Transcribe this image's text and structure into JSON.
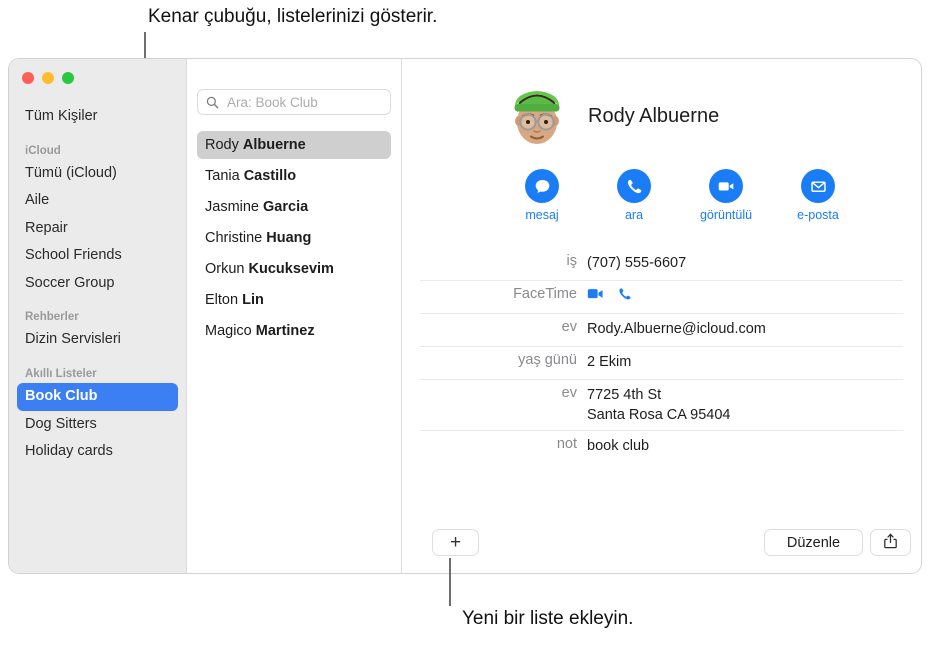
{
  "callouts": {
    "top": "Kenar çubuğu, listelerinizi gösterir.",
    "bottom": "Yeni bir liste ekleyin."
  },
  "colors": {
    "accent": "#1a7df5",
    "selection": "#3b7ff2",
    "list_selection": "#cfcfcf",
    "sidebar_bg": "#ebebeb",
    "traffic_red": "#ff5f57",
    "traffic_yellow": "#febc2e",
    "traffic_green": "#28c840"
  },
  "window": {
    "traffic_lights": [
      "close-button",
      "minimize-button",
      "zoom-button"
    ]
  },
  "sidebar": {
    "top_item": "Tüm Kişiler",
    "sections": [
      {
        "header": "iCloud",
        "items": [
          "Tümü (iCloud)",
          "Aile",
          "Repair",
          "School Friends",
          "Soccer Group"
        ]
      },
      {
        "header": "Rehberler",
        "items": [
          "Dizin Servisleri"
        ]
      },
      {
        "header": "Akıllı Listeler",
        "items": [
          "Book Club",
          "Dog Sitters",
          "Holiday cards"
        ]
      }
    ],
    "selected": "Book Club"
  },
  "search": {
    "placeholder": "Ara: Book Club",
    "value": "",
    "icon": "search-icon"
  },
  "contacts": {
    "items": [
      {
        "first": "Rody ",
        "last": "Albuerne",
        "selected": true
      },
      {
        "first": "Tania ",
        "last": "Castillo",
        "selected": false
      },
      {
        "first": "Jasmine ",
        "last": "Garcia",
        "selected": false
      },
      {
        "first": "Christine ",
        "last": "Huang",
        "selected": false
      },
      {
        "first": "Orkun ",
        "last": "Kucuksevim",
        "selected": false
      },
      {
        "first": "Elton ",
        "last": "Lin",
        "selected": false
      },
      {
        "first": "Magico ",
        "last": "Martinez",
        "selected": false
      }
    ]
  },
  "detail": {
    "name": "Rody Albuerne",
    "avatar": "memoji-avatar",
    "actions": [
      {
        "label": "mesaj",
        "icon": "message-icon"
      },
      {
        "label": "ara",
        "icon": "phone-icon"
      },
      {
        "label": "görüntülü",
        "icon": "video-icon"
      },
      {
        "label": "e-posta",
        "icon": "mail-icon"
      }
    ],
    "fields": [
      {
        "label": "iş",
        "value": "(707) 555-6607",
        "type": "text"
      },
      {
        "label": "FaceTime",
        "value": "",
        "type": "facetime-icons"
      },
      {
        "label": "ev",
        "value": "Rody.Albuerne@icloud.com",
        "type": "text"
      },
      {
        "label": "yaş günü",
        "value": "2 Ekim",
        "type": "text"
      },
      {
        "label": "ev",
        "value": "7725 4th St",
        "value2": "Santa Rosa CA 95404",
        "type": "address"
      },
      {
        "label": "not",
        "value": "book club",
        "type": "text"
      }
    ]
  },
  "toolbar": {
    "add_label": "+",
    "edit_label": "Düzenle",
    "share_icon": "share-icon"
  }
}
